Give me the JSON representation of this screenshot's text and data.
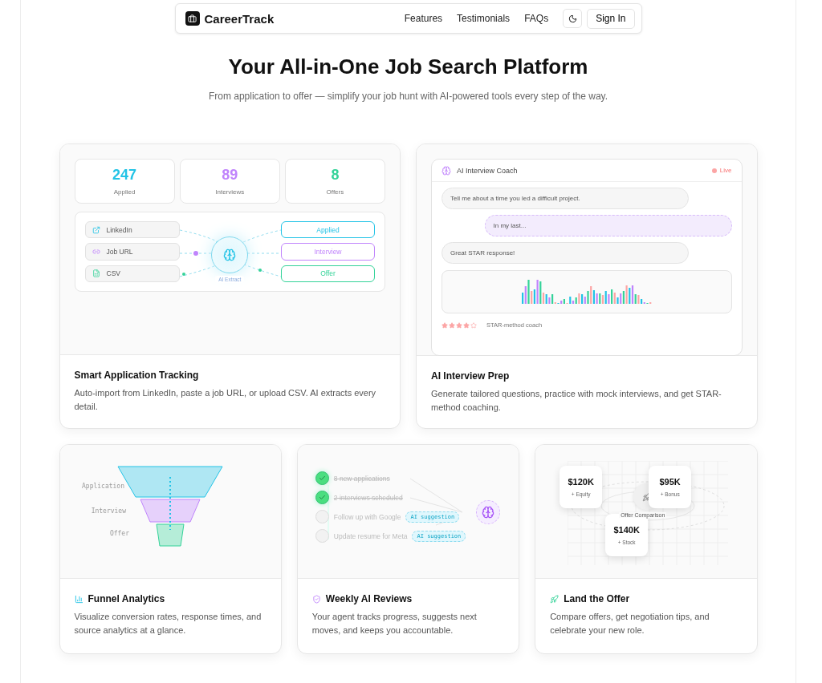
{
  "nav": {
    "brand": "CareerTrack",
    "links": [
      "Features",
      "Testimonials",
      "FAQs"
    ],
    "button": "Sign In"
  },
  "hero": {
    "title": "Your All-in-One Job Search Platform",
    "subtitle": "From application to offer — simplify your job hunt with AI-powered tools every step of the way."
  },
  "features": [
    {
      "kind": "tracking",
      "title": "Smart Application Tracking",
      "description": "Auto-import from LinkedIn, paste a job URL, or upload CSV. AI extracts every detail.",
      "stats": [
        {
          "value": "247",
          "label": "Applied",
          "color": "#22c3e6"
        },
        {
          "value": "89",
          "label": "Interviews",
          "color": "#c084fc"
        },
        {
          "value": "8",
          "label": "Offers",
          "color": "#34d399"
        }
      ],
      "sources": [
        {
          "label": "LinkedIn"
        },
        {
          "label": "Job URL"
        },
        {
          "label": "CSV"
        }
      ],
      "hub_label": "AI Extract",
      "stages": [
        {
          "label": "Applied",
          "color": "#22c3e6"
        },
        {
          "label": "Interview",
          "color": "#c084fc"
        },
        {
          "label": "Offer",
          "color": "#34d399"
        }
      ]
    },
    {
      "kind": "interview",
      "title": "AI Interview Prep",
      "description": "Generate tailored questions, practice with mock interviews, and get STAR-method coaching.",
      "coach_title": "AI Interview Coach",
      "live": "Live",
      "messages": [
        {
          "text": "Tell me about a time you led a difficult project.",
          "kind": "question"
        },
        {
          "text": "In my last...",
          "kind": "answer"
        },
        {
          "text": "Great STAR response!",
          "kind": "question"
        }
      ],
      "stars": 4,
      "rating_label": "STAR-method coach"
    },
    {
      "kind": "funnel",
      "title": "Funnel Analytics",
      "description": "Visualize conversion rates, response times, and source analytics at a glance.",
      "stages": [
        {
          "label": "Application",
          "color": "#22c3e6"
        },
        {
          "label": "Interview",
          "color": "#c084fc"
        },
        {
          "label": "Offer",
          "color": "#34d399"
        }
      ]
    },
    {
      "kind": "reviews",
      "title": "Weekly AI Reviews",
      "description": "Your agent tracks progress, suggests next moves, and keeps you accountable.",
      "tasks": [
        {
          "text": "8 new applications",
          "done": true
        },
        {
          "text": "2 interviews scheduled",
          "done": true
        },
        {
          "text": "Follow up with Google",
          "done": false,
          "badge": "AI suggestion"
        },
        {
          "text": "Update resume for Meta",
          "done": false,
          "badge": "AI suggestion"
        }
      ]
    },
    {
      "kind": "offers",
      "title": "Land the Offer",
      "description": "Compare offers, get negotiation tips, and celebrate your new role.",
      "offers": [
        {
          "amount": "$120K",
          "perk": "+ Equity"
        },
        {
          "amount": "$95K",
          "perk": "+ Bonus"
        },
        {
          "amount": "$140K",
          "perk": "+ Stock"
        }
      ],
      "center_label": "Offer Comparison"
    }
  ]
}
